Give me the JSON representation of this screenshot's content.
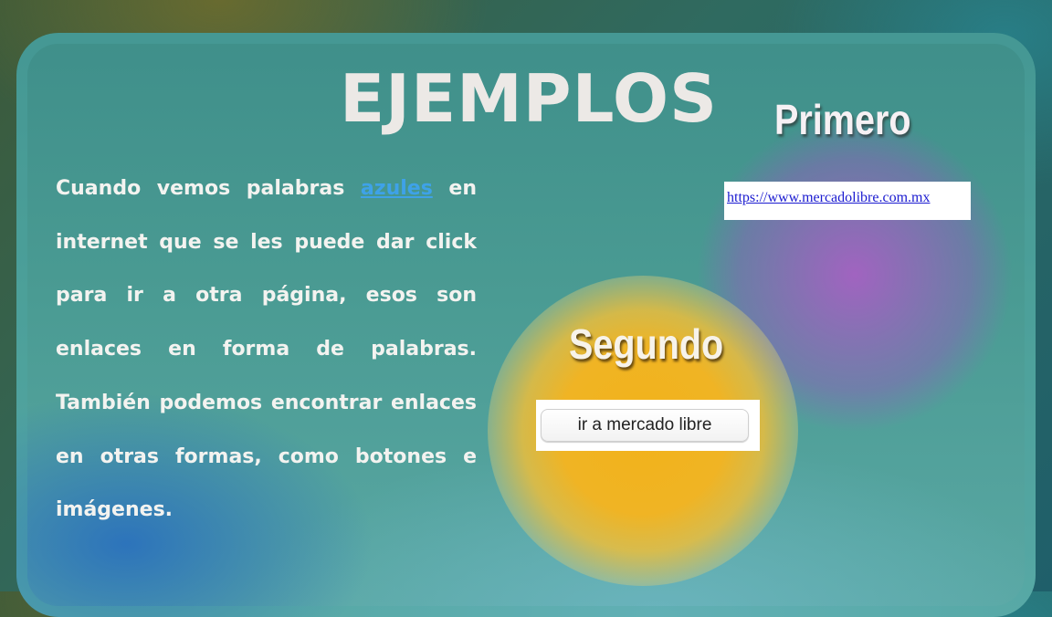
{
  "slide": {
    "title": "EJEMPLOS",
    "paragraph": {
      "before_link": "Cuando vemos palabras ",
      "link_word": "azules",
      "after_link": " en internet que se les puede dar click para ir a otra página, esos son enlaces en forma de palabras. También podemos encontrar enlaces en otras formas, como botones e imágenes."
    },
    "first": {
      "heading": "Primero",
      "link_text": "https://www.mercadolibre.com.mx"
    },
    "second": {
      "heading": "Segundo",
      "button_label": "ir a mercado libre"
    }
  },
  "colors": {
    "link_blue": "#3ea2e8",
    "accent_purple": "#b05ac8",
    "accent_yellow": "#f2b21a"
  }
}
